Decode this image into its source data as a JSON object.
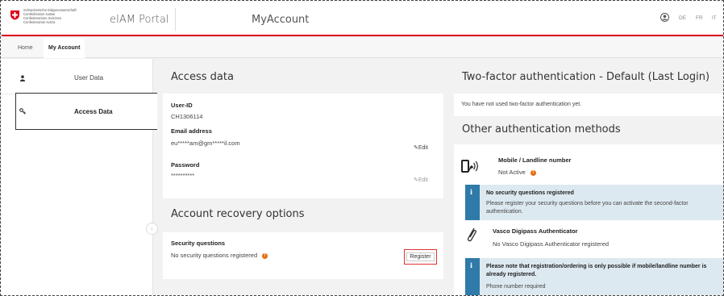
{
  "header": {
    "confederation_lines": [
      "Schweizerische Eidgenossenschaft",
      "Confédération suisse",
      "Confederazione Svizzera",
      "Confederaziun svizra"
    ],
    "portal_name": "eIAM Portal",
    "app_name": "MyAccount",
    "languages": [
      "DE",
      "FR",
      "IT"
    ]
  },
  "breadcrumb": {
    "home": "Home",
    "current": "My Account"
  },
  "sidebar": {
    "items": [
      {
        "label": "User Data",
        "icon": "person-icon"
      },
      {
        "label": "Access Data",
        "icon": "key-icon",
        "active": true
      }
    ]
  },
  "access_data": {
    "title": "Access data",
    "user_id_label": "User-ID",
    "user_id_value": "CH1306114",
    "email_label": "Email address",
    "email_value": "eu*****am@gm*****il.com",
    "email_edit": "Edit",
    "password_label": "Password",
    "password_value": "**********",
    "password_edit": "Edit"
  },
  "recovery": {
    "title": "Account recovery options",
    "security_label": "Security questions",
    "security_value": "No security questions registered",
    "warn_symbol": "!",
    "register_label": "Register"
  },
  "twofa": {
    "title": "Two-factor authentication - Default (Last Login)",
    "status_text": "You have not used two-factor authentication yet."
  },
  "other_methods": {
    "title": "Other authentication methods",
    "mobile_title": "Mobile / Landline number",
    "mobile_status": "Not Active",
    "warn_symbol": "!",
    "info1_symbol": "i",
    "info1_title": "No security questions registered",
    "info1_text": "Please register your security questions before you can activate the second-factor authentication.",
    "vasco_title": "Vasco Digipass Authenticator",
    "vasco_status": "No Vasco Digipass Authenticator registered",
    "info2_symbol": "i",
    "info2_title": "Please note that registration/ordering is only possible if mobile/landline number is already registered.",
    "info2_text": "Phone number required"
  },
  "colors": {
    "accent_red": "#dc0018",
    "info_blue": "#2f7aa8",
    "warn_orange": "#e56e12"
  }
}
